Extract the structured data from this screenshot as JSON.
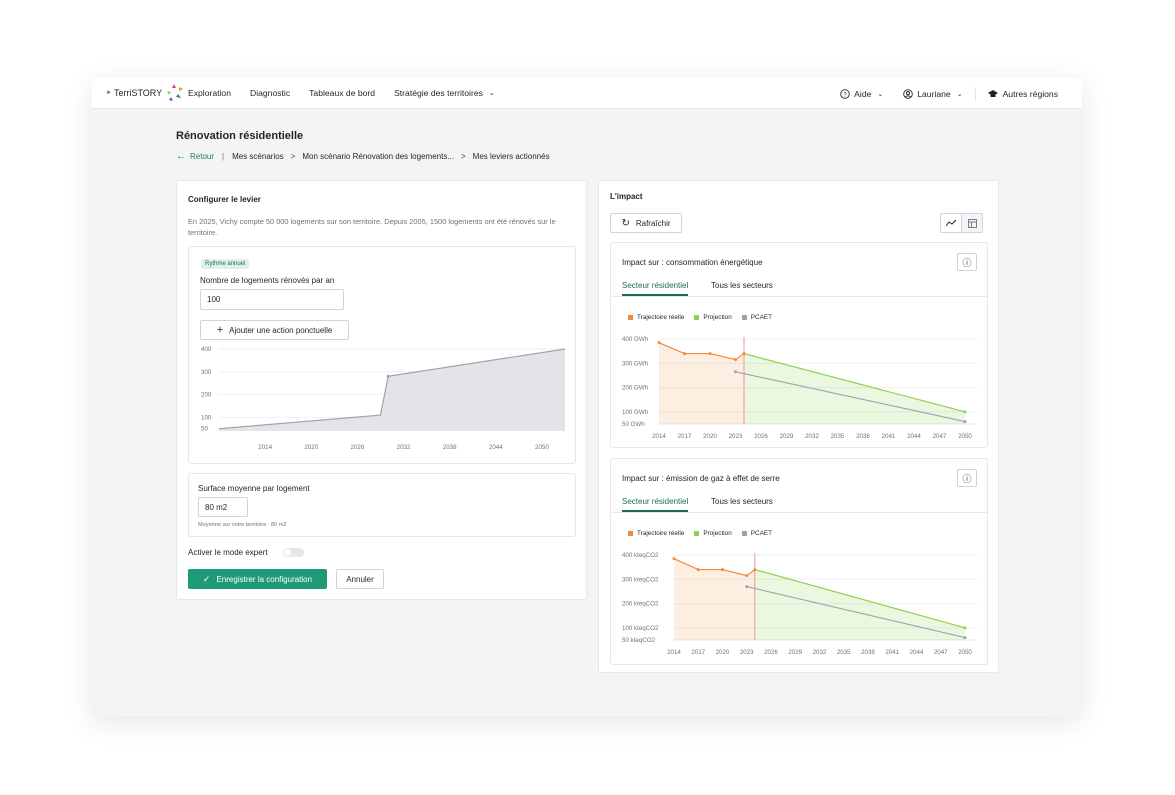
{
  "app": {
    "logo_text": "TerriSTORY",
    "nav": [
      "Exploration",
      "Diagnostic",
      "Tableaux de bord",
      "Stratégie des territoires"
    ],
    "help_label": "Aide",
    "user_label": "Lauriane",
    "regions_label": "Autres régions"
  },
  "page": {
    "title": "Rénovation résidentielle",
    "breadcrumb": {
      "back": "Retour",
      "items": [
        "Mes scénarios",
        "Mon scénario Rénovation des logements...",
        "Mes leviers actionnés"
      ]
    }
  },
  "config": {
    "title": "Configurer le levier",
    "description": "En 2025, Vichy compte 50 000 logements sur son territoire. Depuis 2005, 1500 logements ont été rénovés sur le territoire.",
    "badge": "Rythme annuel",
    "count_label": "Nombre de logements rénovés par an",
    "count_value": "100",
    "add_action_label": "Ajouter une action ponctuelle",
    "surface_label": "Surface moyenne par logement",
    "surface_value": "80 m2",
    "surface_hint": "Moyenne sur votre territoire : 80 m2",
    "expert_label": "Activer le mode expert",
    "expert_on": false,
    "save_label": "Enregistrer la configuration",
    "cancel_label": "Annuler"
  },
  "impact": {
    "title": "L'impact",
    "refresh_label": "Rafraîchir",
    "tabs": [
      "Secteur résidentiel",
      "Tous les secteurs"
    ],
    "legend": [
      "Trajectoire réelle",
      "Projection",
      "PCAET"
    ],
    "energy_title": "Impact sur : consommation énergétique",
    "ghg_title": "Impact sur : émission de gaz à effet de serre"
  },
  "colors": {
    "accent": "#1e9b76",
    "real": "#f08a3c",
    "projection": "#8fd14f",
    "pcaet": "#9ca3af",
    "lever": "#9ca3af"
  },
  "chart_data": [
    {
      "type": "area",
      "name": "lever",
      "x": [
        2008,
        2029,
        2030,
        2053
      ],
      "values": [
        50,
        110,
        280,
        400
      ],
      "ylim": [
        40,
        400
      ],
      "yticks": [
        400,
        300,
        200,
        100,
        50
      ],
      "xticks": [
        2014,
        2020,
        2026,
        2032,
        2038,
        2044,
        2050
      ],
      "xlim": [
        2008,
        2053
      ]
    },
    {
      "type": "line",
      "name": "energy",
      "title": "Impact sur : consommation énergétique",
      "ylabels": [
        "400 GWh",
        "300 GWh",
        "200 GWh",
        "100 GWh",
        "50 GWh"
      ],
      "yticks": [
        400,
        300,
        200,
        100,
        50
      ],
      "ylim": [
        50,
        400
      ],
      "xticks": [
        2014,
        2017,
        2020,
        2023,
        2026,
        2029,
        2032,
        2035,
        2038,
        2041,
        2044,
        2047,
        2050
      ],
      "xlim": [
        2014,
        2050
      ],
      "series": [
        {
          "name": "Trajectoire réelle",
          "x": [
            2014,
            2017,
            2020,
            2023,
            2024
          ],
          "values": [
            385,
            340,
            340,
            315,
            340
          ]
        },
        {
          "name": "Projection",
          "x": [
            2024,
            2050
          ],
          "values": [
            340,
            100
          ]
        },
        {
          "name": "PCAET",
          "x": [
            2023,
            2050
          ],
          "values": [
            265,
            60
          ]
        }
      ]
    },
    {
      "type": "line",
      "name": "ghg",
      "title": "Impact sur : émission de gaz à effet de serre",
      "ylabels": [
        "400 kteqCO2",
        "300 kteqCO2",
        "200 kteqCO2",
        "100 kteqCO2",
        "50 kteqCO2"
      ],
      "yticks": [
        400,
        300,
        200,
        100,
        50
      ],
      "ylim": [
        50,
        400
      ],
      "xticks": [
        2014,
        2017,
        2020,
        2023,
        2026,
        2029,
        2032,
        2035,
        2038,
        2041,
        2044,
        2047,
        2050
      ],
      "xlim": [
        2014,
        2050
      ],
      "series": [
        {
          "name": "Trajectoire réelle",
          "x": [
            2014,
            2017,
            2020,
            2023,
            2024
          ],
          "values": [
            385,
            340,
            340,
            315,
            340
          ]
        },
        {
          "name": "Projection",
          "x": [
            2024,
            2050
          ],
          "values": [
            340,
            100
          ]
        },
        {
          "name": "PCAET",
          "x": [
            2023,
            2050
          ],
          "values": [
            270,
            60
          ]
        }
      ]
    }
  ]
}
